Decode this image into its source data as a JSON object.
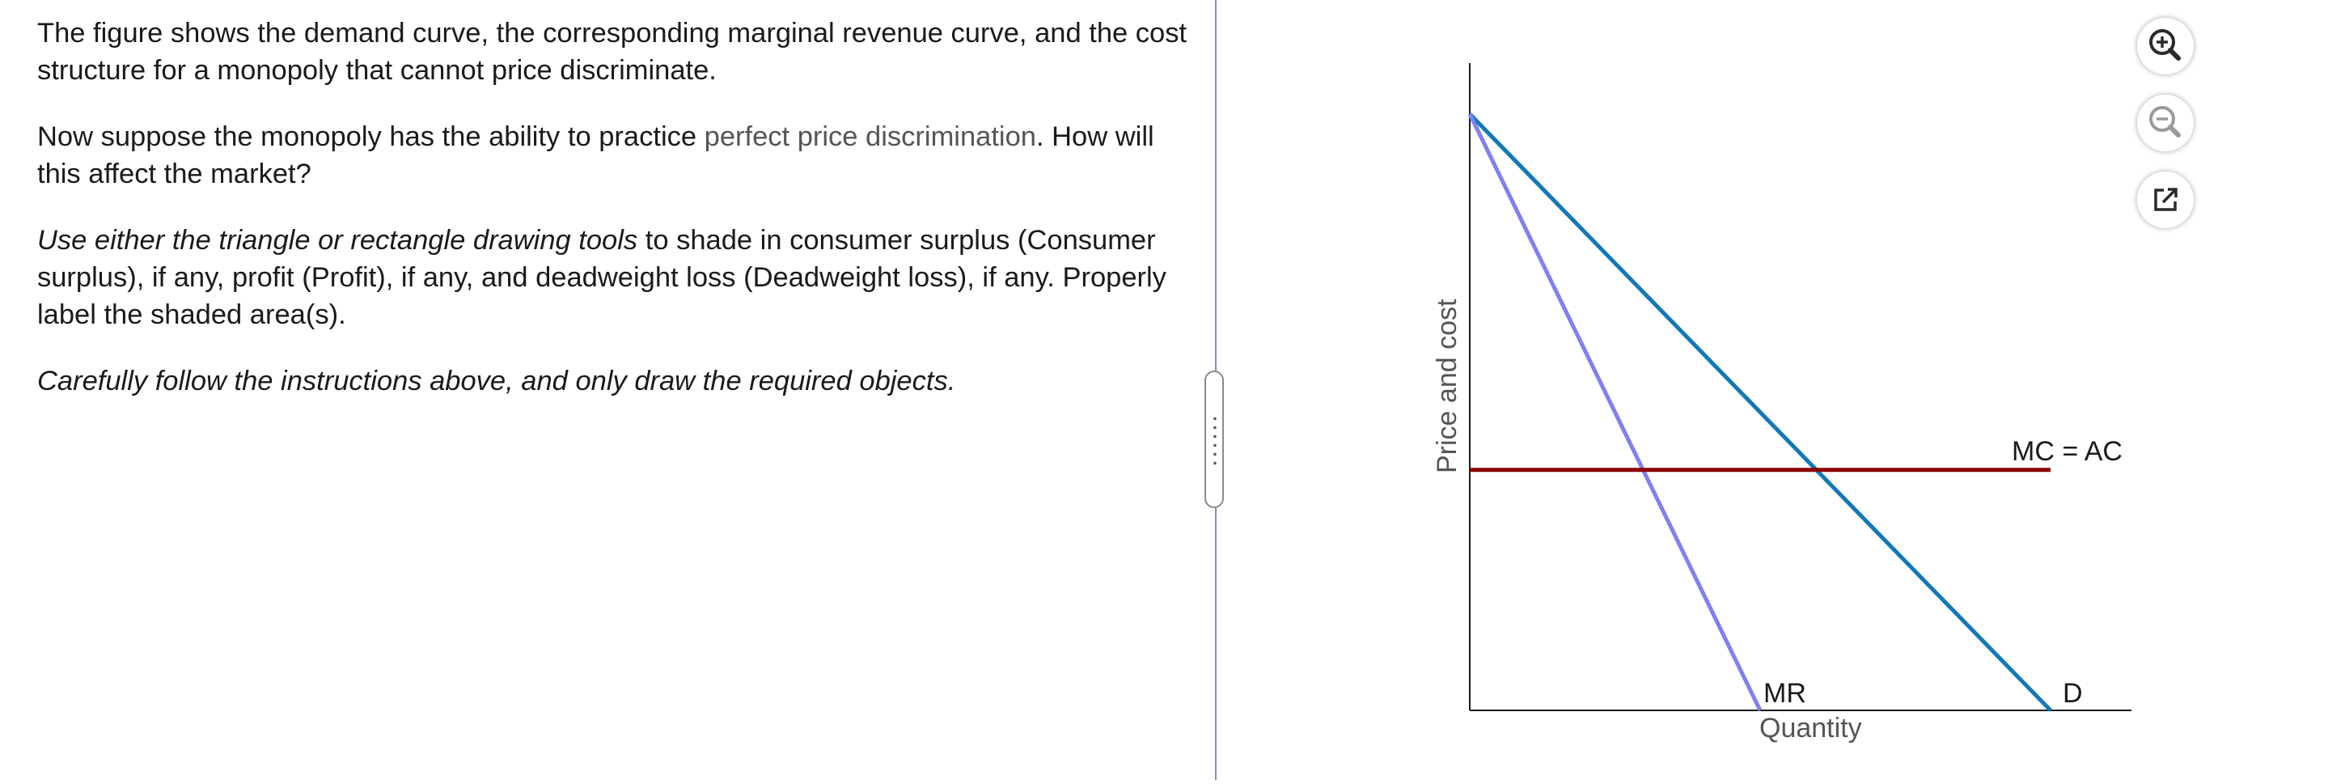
{
  "question": {
    "p1": "The figure shows the demand curve, the corresponding marginal revenue curve, and the cost structure for a monopoly that cannot price discriminate.",
    "p2_a": "Now suppose the monopoly has the ability to practice ",
    "p2_hint": "perfect price discrimination",
    "p2_b": ". How will this affect the market?",
    "p3_italic": "Use either the triangle or rectangle drawing tools",
    "p3_rest": " to shade in consumer surplus (Consumer surplus), if any, profit (Profit), if any, and deadweight loss (Deadweight loss), if any. Properly label the shaded area(s).",
    "p4": "Carefully follow the instructions above, and only draw the required objects."
  },
  "graph": {
    "y_axis_label": "Price and cost",
    "x_axis_label": "Quantity",
    "mc_label": "MC = AC",
    "mr_label": "MR",
    "d_label": "D",
    "colors": {
      "demand": "#1278b8",
      "mr": "#8080f0",
      "mc": "#8b0000",
      "axis": "#1a1a1a"
    }
  },
  "chart_data": {
    "type": "line",
    "title": "",
    "xlabel": "Quantity",
    "ylabel": "Price and cost",
    "xlim": [
      0,
      1
    ],
    "ylim": [
      0,
      1
    ],
    "series": [
      {
        "name": "D",
        "x": [
          0,
          1
        ],
        "y": [
          0.91,
          0
        ]
      },
      {
        "name": "MR",
        "x": [
          0,
          0.5
        ],
        "y": [
          0.91,
          0
        ]
      },
      {
        "name": "MC = AC",
        "x": [
          0,
          1
        ],
        "y": [
          0.367,
          0.367
        ]
      }
    ]
  },
  "toolbar": {
    "zoom_in": "zoom-in-icon",
    "zoom_out": "zoom-out-icon",
    "popout": "external-link-icon"
  }
}
